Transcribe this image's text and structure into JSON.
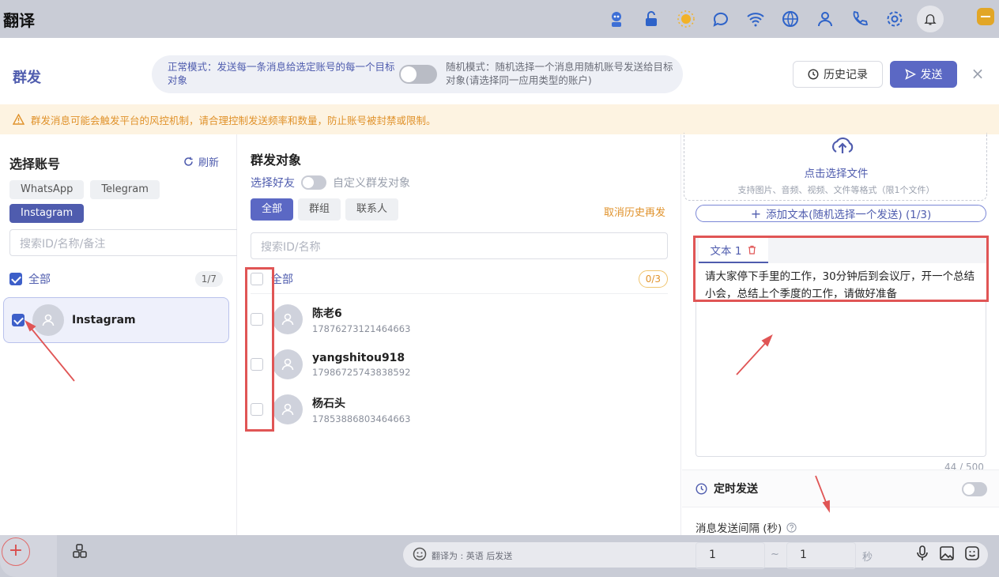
{
  "app": {
    "title": "翻译"
  },
  "modal": {
    "title": "群发",
    "mode_normal": "正常模式：发送每一条消息给选定账号的每一个目标对象",
    "mode_random": "随机模式：随机选择一个消息用随机账号发送给目标对象(请选择同一应用类型的账户)",
    "history_label": "历史记录",
    "send_label": "发送",
    "close_symbol": "×",
    "warning": "群发消息可能会触发平台的风控机制，请合理控制发送频率和数量，防止账号被封禁或限制。"
  },
  "accounts": {
    "title": "选择账号",
    "refresh_label": "刷新",
    "platforms": [
      "WhatsApp",
      "Telegram",
      "Instagram"
    ],
    "active_platform": "Instagram",
    "search_placeholder": "搜索ID/名称/备注",
    "all_label": "全部",
    "count": "1/7",
    "items": [
      {
        "name": "Instagram",
        "checked": true
      }
    ]
  },
  "targets": {
    "title": "群发对象",
    "select_friends_label": "选择好友",
    "custom_label": "自定义群发对象",
    "tabs": [
      "全部",
      "群组",
      "联系人"
    ],
    "active_tab": "全部",
    "cancel_resend": "取消历史再发",
    "search_placeholder": "搜索ID/名称",
    "all_label": "全部",
    "count": "0/3",
    "contacts": [
      {
        "name": "陈老6",
        "id": "17876273121464663"
      },
      {
        "name": "yangshitou918",
        "id": "17986725743838592"
      },
      {
        "name": "杨石头",
        "id": "17853886803464663"
      }
    ]
  },
  "message": {
    "upload_link": "点击选择文件",
    "upload_hint": "支持图片、音频、视频、文件等格式（限1个文件）",
    "add_text_label": "添加文本(随机选择一个发送) (1/3)",
    "tab_label": "文本 1",
    "text": "请大家停下手里的工作，30分钟后到会议厅，开一个总结小会，总结上个季度的工作，请做好准备",
    "char_count": "44 / 500",
    "scheduled_label": "定时发送",
    "interval_label": "消息发送间隔 (秒)",
    "interval_min": "1",
    "interval_max": "1",
    "tilde": "~",
    "unit": "秒"
  },
  "bottom_bar": {
    "translate_hint": "翻译为 : 英语 后发送",
    "add_symbol": "+"
  },
  "colors": {
    "accent": "#4f5cae",
    "send": "#5b68c4",
    "warning_text": "#e0922b",
    "annotation": "#e05555"
  },
  "icons": [
    "robot-icon",
    "lock-icon",
    "sun-icon",
    "chat-icon",
    "wifi-icon",
    "globe-icon",
    "user-icon",
    "phone-icon",
    "gear-icon",
    "bell-icon",
    "minimize-icon"
  ]
}
